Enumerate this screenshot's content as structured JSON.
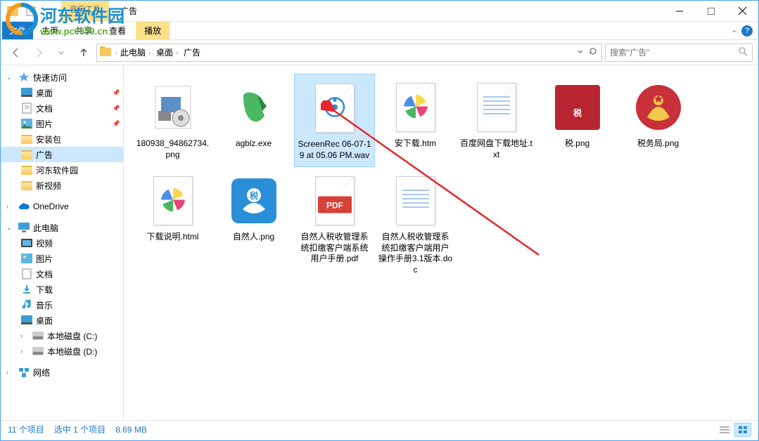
{
  "window": {
    "title": "广告",
    "music_tools_label": "音乐工具"
  },
  "ribbon": {
    "file_menu": "文件",
    "tabs": [
      "主页",
      "共享",
      "查看"
    ],
    "play_tab": "播放"
  },
  "nav": {
    "breadcrumb": [
      "此电脑",
      "桌面",
      "广告"
    ],
    "search_placeholder": "搜索\"广告\""
  },
  "sidebar": {
    "quick_access": "快速访问",
    "quick_items": [
      "桌面",
      "文档",
      "图片",
      "安装包",
      "广告",
      "河东软件园",
      "新视频"
    ],
    "onedrive": "OneDrive",
    "thispc": "此电脑",
    "thispc_items": [
      "视频",
      "图片",
      "文档",
      "下载",
      "音乐",
      "桌面",
      "本地磁盘 (C:)",
      "本地磁盘 (D:)"
    ],
    "network": "网络"
  },
  "files": [
    {
      "name": "180938_94862734.png",
      "type": "png"
    },
    {
      "name": "agblz.exe",
      "type": "exe"
    },
    {
      "name": "ScreenRec 06-07-19 at 05.06 PM.wav",
      "type": "wav",
      "selected": true
    },
    {
      "name": "安下载.htm",
      "type": "htm"
    },
    {
      "name": "百度网盘下载地址.txt",
      "type": "txt"
    },
    {
      "name": "税.png",
      "type": "png-tax"
    },
    {
      "name": "税务局.png",
      "type": "png-taxoffice"
    },
    {
      "name": "下载说明.html",
      "type": "html"
    },
    {
      "name": "自然人.png",
      "type": "png-natural"
    },
    {
      "name": "自然人税收管理系统扣缴客户端系统用户手册.pdf",
      "type": "pdf"
    },
    {
      "name": "自然人税收管理系统扣缴客户端用户操作手册3.1版本.doc",
      "type": "doc"
    }
  ],
  "status": {
    "item_count": "11 个项目",
    "selected": "选中 1 个项目",
    "size": "8.69 MB"
  },
  "watermark": {
    "brand": "河东软件园",
    "url": "www.pc0359.cn"
  }
}
